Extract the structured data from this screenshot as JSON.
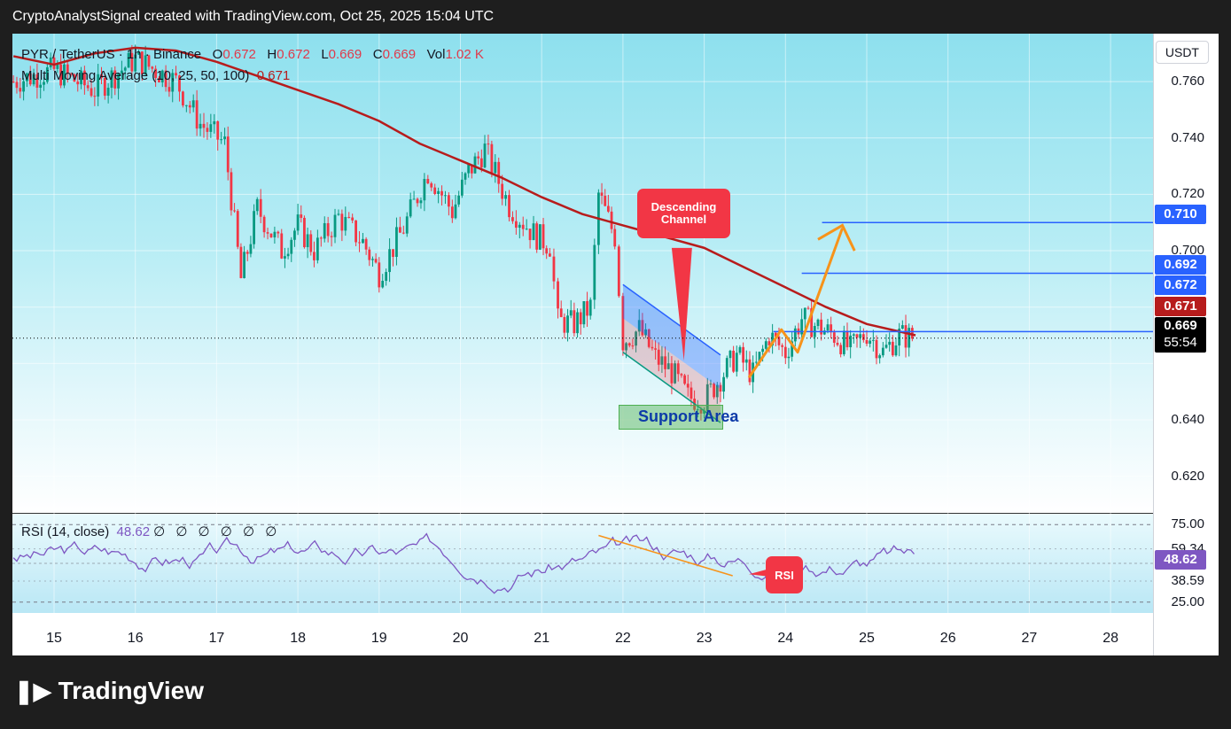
{
  "header": {
    "credit": "CryptoAnalystSignal created with TradingView.com, Oct 25, 2025 15:04 UTC"
  },
  "legend": {
    "symbol": "PYR / TetherUS · 1h · Binance",
    "o_label": "O",
    "o": "0.672",
    "h_label": "H",
    "h": "0.672",
    "l_label": "L",
    "l": "0.669",
    "c_label": "C",
    "c": "0.669",
    "vol_label": "Vol",
    "vol": "1.02 K",
    "ma_label": "Multi Moving Average (10, 25, 50, 100)",
    "ma_value": "0.671"
  },
  "rsi_legend": {
    "label": "RSI (14, close)",
    "value": "48.62",
    "zeros": "∅ ∅ ∅ ∅ ∅ ∅"
  },
  "currency": "USDT",
  "annotations": {
    "channel": "Descending Channel",
    "support": "Support Area",
    "rsi": "RSI"
  },
  "price_ticks": [
    "0.760",
    "0.740",
    "0.720",
    "0.700",
    "0.640",
    "0.620"
  ],
  "price_tags": {
    "t710": "0.710",
    "t692": "0.692",
    "t672": "0.672",
    "t671": "0.671",
    "t669": "0.669",
    "countdown": "55:54"
  },
  "rsi_ticks": [
    "75.00",
    "59.34",
    "38.59",
    "25.00"
  ],
  "rsi_tag": "48.62",
  "dates": [
    "15",
    "16",
    "17",
    "18",
    "19",
    "20",
    "21",
    "22",
    "23",
    "24",
    "25",
    "26",
    "27",
    "28"
  ],
  "brand": "TradingView",
  "colors": {
    "up": "#089981",
    "down": "#f23645",
    "ma": "#b71c1c",
    "rsi": "#7e57c2",
    "level": "#2962ff",
    "arrow": "#f7931a",
    "tag_blue": "#2962ff",
    "tag_red": "#b71c1c"
  },
  "chart_data": {
    "type": "candlestick",
    "symbol": "PYR / TetherUS",
    "interval": "1h",
    "y_range": [
      0.607,
      0.777
    ],
    "x_range_days": [
      "14",
      "28"
    ],
    "ma_100": [
      [
        14.5,
        0.769
      ],
      [
        15,
        0.766
      ],
      [
        15.5,
        0.77
      ],
      [
        16,
        0.772
      ],
      [
        16.5,
        0.771
      ],
      [
        17,
        0.767
      ],
      [
        17.5,
        0.762
      ],
      [
        18,
        0.757
      ],
      [
        18.5,
        0.752
      ],
      [
        19,
        0.746
      ],
      [
        19.5,
        0.738
      ],
      [
        20,
        0.732
      ],
      [
        20.5,
        0.726
      ],
      [
        21,
        0.719
      ],
      [
        21.5,
        0.713
      ],
      [
        22,
        0.709
      ],
      [
        22.5,
        0.705
      ],
      [
        23,
        0.701
      ],
      [
        23.5,
        0.694
      ],
      [
        24,
        0.687
      ],
      [
        24.5,
        0.68
      ],
      [
        25,
        0.674
      ],
      [
        25.6,
        0.67
      ]
    ],
    "close_path": [
      [
        14.5,
        0.76
      ],
      [
        15,
        0.764
      ],
      [
        15.5,
        0.757
      ],
      [
        16,
        0.768
      ],
      [
        16.5,
        0.76
      ],
      [
        16.8,
        0.745
      ],
      [
        17.1,
        0.738
      ],
      [
        17.3,
        0.69
      ],
      [
        17.5,
        0.715
      ],
      [
        17.8,
        0.7
      ],
      [
        18,
        0.709
      ],
      [
        18.2,
        0.7
      ],
      [
        18.5,
        0.712
      ],
      [
        18.8,
        0.703
      ],
      [
        19,
        0.692
      ],
      [
        19.3,
        0.708
      ],
      [
        19.6,
        0.728
      ],
      [
        19.9,
        0.714
      ],
      [
        20.1,
        0.728
      ],
      [
        20.3,
        0.736
      ],
      [
        20.6,
        0.716
      ],
      [
        20.9,
        0.706
      ],
      [
        21.1,
        0.702
      ],
      [
        21.2,
        0.675
      ],
      [
        21.4,
        0.674
      ],
      [
        21.6,
        0.68
      ],
      [
        21.7,
        0.72
      ],
      [
        21.9,
        0.705
      ],
      [
        22,
        0.668
      ],
      [
        22.2,
        0.672
      ],
      [
        22.4,
        0.662
      ],
      [
        22.6,
        0.657
      ],
      [
        22.8,
        0.648
      ],
      [
        23,
        0.647
      ],
      [
        23.2,
        0.655
      ],
      [
        23.4,
        0.663
      ],
      [
        23.6,
        0.656
      ],
      [
        23.8,
        0.67
      ],
      [
        24,
        0.664
      ],
      [
        24.2,
        0.676
      ],
      [
        24.4,
        0.673
      ],
      [
        24.6,
        0.67
      ],
      [
        24.8,
        0.665
      ],
      [
        25,
        0.671
      ],
      [
        25.2,
        0.664
      ],
      [
        25.4,
        0.67
      ],
      [
        25.6,
        0.669
      ]
    ],
    "horizontal_levels": [
      0.71,
      0.692,
      0.669
    ],
    "current_price": 0.669,
    "rsi": {
      "period": 14,
      "value": 48.62,
      "levels": [
        75.0,
        59.34,
        38.59,
        25.0
      ],
      "range": [
        18,
        82
      ]
    }
  }
}
